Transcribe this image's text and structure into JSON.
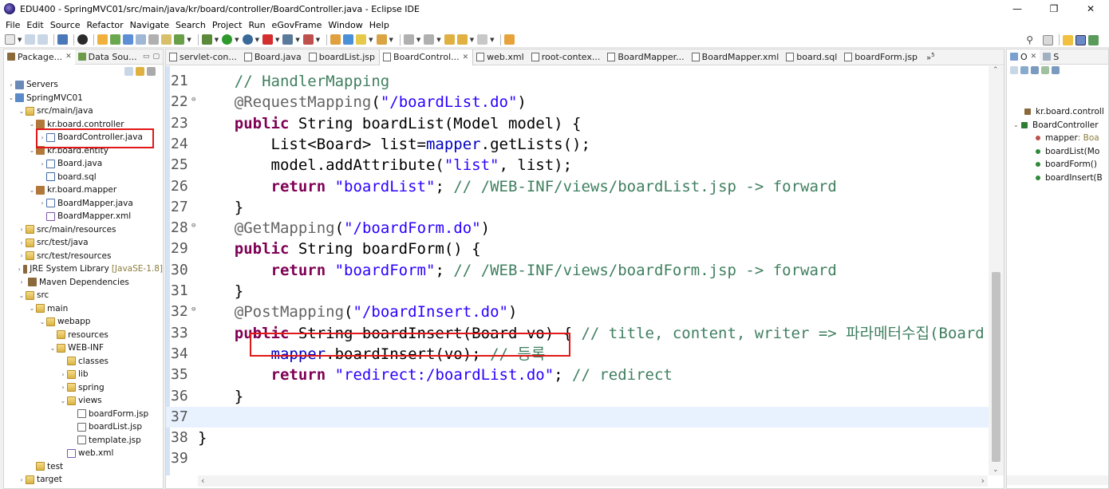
{
  "window": {
    "title": "EDU400 - SpringMVC01/src/main/java/kr/board/controller/BoardController.java - Eclipse IDE",
    "controls": [
      "—",
      "❐",
      "✕"
    ]
  },
  "menubar": [
    "File",
    "Edit",
    "Source",
    "Refactor",
    "Navigate",
    "Search",
    "Project",
    "Run",
    "eGovFrame",
    "Window",
    "Help"
  ],
  "left_view": {
    "tabs": [
      {
        "label": "Package...",
        "close": "✕"
      },
      {
        "label": "Data Sou..."
      }
    ],
    "minmax": [
      "▭",
      "▢"
    ],
    "tree": [
      {
        "depth": 0,
        "twisty": "›",
        "icon": "server",
        "label": "Servers"
      },
      {
        "depth": 0,
        "twisty": "⌄",
        "icon": "proj",
        "label": "SpringMVC01"
      },
      {
        "depth": 1,
        "twisty": "⌄",
        "icon": "folder",
        "label": "src/main/java"
      },
      {
        "depth": 2,
        "twisty": "⌄",
        "icon": "pkg",
        "label": "kr.board.controller"
      },
      {
        "depth": 3,
        "twisty": "›",
        "icon": "java",
        "label": "BoardController.java"
      },
      {
        "depth": 2,
        "twisty": "⌄",
        "icon": "pkg",
        "label": "kr.board.entity"
      },
      {
        "depth": 3,
        "twisty": "›",
        "icon": "java",
        "label": "Board.java"
      },
      {
        "depth": 3,
        "twisty": "",
        "icon": "sql",
        "label": "board.sql"
      },
      {
        "depth": 2,
        "twisty": "⌄",
        "icon": "pkg",
        "label": "kr.board.mapper"
      },
      {
        "depth": 3,
        "twisty": "›",
        "icon": "java",
        "label": "BoardMapper.java"
      },
      {
        "depth": 3,
        "twisty": "",
        "icon": "xml",
        "label": "BoardMapper.xml"
      },
      {
        "depth": 1,
        "twisty": "›",
        "icon": "folder",
        "label": "src/main/resources"
      },
      {
        "depth": 1,
        "twisty": "›",
        "icon": "folder",
        "label": "src/test/java"
      },
      {
        "depth": 1,
        "twisty": "›",
        "icon": "folder",
        "label": "src/test/resources"
      },
      {
        "depth": 1,
        "twisty": "›",
        "icon": "lib",
        "label": "JRE System Library",
        "extra": "[JavaSE-1.8]"
      },
      {
        "depth": 1,
        "twisty": "›",
        "icon": "lib",
        "label": "Maven Dependencies"
      },
      {
        "depth": 1,
        "twisty": "⌄",
        "icon": "folder",
        "label": "src"
      },
      {
        "depth": 2,
        "twisty": "⌄",
        "icon": "folder",
        "label": "main"
      },
      {
        "depth": 3,
        "twisty": "⌄",
        "icon": "folder",
        "label": "webapp"
      },
      {
        "depth": 4,
        "twisty": "",
        "icon": "folder",
        "label": "resources"
      },
      {
        "depth": 4,
        "twisty": "⌄",
        "icon": "folder",
        "label": "WEB-INF"
      },
      {
        "depth": 5,
        "twisty": "",
        "icon": "folder",
        "label": "classes"
      },
      {
        "depth": 5,
        "twisty": "›",
        "icon": "folder",
        "label": "lib"
      },
      {
        "depth": 5,
        "twisty": "›",
        "icon": "folder",
        "label": "spring"
      },
      {
        "depth": 5,
        "twisty": "⌄",
        "icon": "folder",
        "label": "views"
      },
      {
        "depth": 6,
        "twisty": "",
        "icon": "jsp",
        "label": "boardForm.jsp"
      },
      {
        "depth": 6,
        "twisty": "",
        "icon": "jsp",
        "label": "boardList.jsp"
      },
      {
        "depth": 6,
        "twisty": "",
        "icon": "jsp",
        "label": "template.jsp"
      },
      {
        "depth": 5,
        "twisty": "",
        "icon": "xml",
        "label": "web.xml"
      },
      {
        "depth": 2,
        "twisty": "",
        "icon": "folder",
        "label": "test"
      },
      {
        "depth": 1,
        "twisty": "›",
        "icon": "folder",
        "label": "target"
      }
    ]
  },
  "editor": {
    "tabs": [
      {
        "label": "servlet-con..."
      },
      {
        "label": "Board.java"
      },
      {
        "label": "boardList.jsp"
      },
      {
        "label": "BoardControl...",
        "active": true,
        "close": "✕"
      },
      {
        "label": "web.xml"
      },
      {
        "label": "root-contex..."
      },
      {
        "label": "BoardMapper..."
      },
      {
        "label": "BoardMapper.xml"
      },
      {
        "label": "board.sql"
      },
      {
        "label": "boardForm.jsp"
      }
    ],
    "overflow": "»",
    "overflow_count": "5",
    "lines": [
      {
        "n": "21",
        "fold": "",
        "tokens": [
          {
            "t": "    "
          },
          {
            "t": "// HandlerMapping",
            "c": "cm"
          }
        ]
      },
      {
        "n": "22",
        "fold": "⊖",
        "tokens": [
          {
            "t": "    "
          },
          {
            "t": "@RequestMapping",
            "c": "ann"
          },
          {
            "t": "("
          },
          {
            "t": "\"/boardList.do\"",
            "c": "str"
          },
          {
            "t": ")"
          }
        ]
      },
      {
        "n": "23",
        "fold": "",
        "tokens": [
          {
            "t": "    "
          },
          {
            "t": "public",
            "c": "kw"
          },
          {
            "t": " String boardList(Model model) {"
          }
        ]
      },
      {
        "n": "24",
        "fold": "",
        "tokens": [
          {
            "t": "        List<Board> list="
          },
          {
            "t": "mapper",
            "c": "fld"
          },
          {
            "t": ".getLists();"
          }
        ]
      },
      {
        "n": "25",
        "fold": "",
        "tokens": [
          {
            "t": "        model.addAttribute("
          },
          {
            "t": "\"list\"",
            "c": "str"
          },
          {
            "t": ", list);"
          }
        ]
      },
      {
        "n": "26",
        "fold": "",
        "tokens": [
          {
            "t": "        "
          },
          {
            "t": "return",
            "c": "kw"
          },
          {
            "t": " "
          },
          {
            "t": "\"boardList\"",
            "c": "str"
          },
          {
            "t": "; "
          },
          {
            "t": "// /WEB-INF/views/boardList.jsp -> forward",
            "c": "cm"
          }
        ]
      },
      {
        "n": "27",
        "fold": "",
        "tokens": [
          {
            "t": "    }"
          }
        ]
      },
      {
        "n": "28",
        "fold": "⊖",
        "tokens": [
          {
            "t": "    "
          },
          {
            "t": "@GetMapping",
            "c": "ann"
          },
          {
            "t": "("
          },
          {
            "t": "\"/boardForm.do\"",
            "c": "str"
          },
          {
            "t": ")"
          }
        ]
      },
      {
        "n": "29",
        "fold": "",
        "tokens": [
          {
            "t": "    "
          },
          {
            "t": "public",
            "c": "kw"
          },
          {
            "t": " String boardForm() {"
          }
        ]
      },
      {
        "n": "30",
        "fold": "",
        "tokens": [
          {
            "t": "        "
          },
          {
            "t": "return",
            "c": "kw"
          },
          {
            "t": " "
          },
          {
            "t": "\"boardForm\"",
            "c": "str"
          },
          {
            "t": "; "
          },
          {
            "t": "// /WEB-INF/views/boardForm.jsp -> forward",
            "c": "cm"
          }
        ]
      },
      {
        "n": "31",
        "fold": "",
        "tokens": [
          {
            "t": "    }"
          }
        ]
      },
      {
        "n": "32",
        "fold": "⊖",
        "tokens": [
          {
            "t": "    "
          },
          {
            "t": "@PostMapping",
            "c": "ann"
          },
          {
            "t": "("
          },
          {
            "t": "\"/boardInsert.do\"",
            "c": "str"
          },
          {
            "t": ")"
          }
        ]
      },
      {
        "n": "33",
        "fold": "",
        "tokens": [
          {
            "t": "    "
          },
          {
            "t": "public",
            "c": "kw"
          },
          {
            "t": " String boardInsert(Board vo) { "
          },
          {
            "t": "// title, content, writer => 파라메터수집(Board",
            "c": "cm"
          }
        ]
      },
      {
        "n": "34",
        "fold": "",
        "tokens": [
          {
            "t": "        "
          },
          {
            "t": "mapper",
            "c": "fld"
          },
          {
            "t": ".boardInsert(vo); "
          },
          {
            "t": "// 등록",
            "c": "cm"
          }
        ]
      },
      {
        "n": "35",
        "fold": "",
        "tokens": [
          {
            "t": "        "
          },
          {
            "t": "return",
            "c": "kw"
          },
          {
            "t": " "
          },
          {
            "t": "\"redirect:/boardList.do\"",
            "c": "str"
          },
          {
            "t": "; "
          },
          {
            "t": "// redirect",
            "c": "cm"
          }
        ]
      },
      {
        "n": "36",
        "fold": "",
        "tokens": [
          {
            "t": "    }"
          }
        ]
      },
      {
        "n": "37",
        "fold": "",
        "current": true,
        "tokens": []
      },
      {
        "n": "38",
        "fold": "",
        "tokens": [
          {
            "t": "}"
          }
        ]
      },
      {
        "n": "39",
        "fold": "",
        "tokens": []
      }
    ],
    "scroll_left": "‹",
    "scroll_right": "›",
    "scroll_up": "⌃",
    "scroll_down": "⌄"
  },
  "outline": {
    "tabs": [
      {
        "label": "O",
        "close": "✕"
      },
      {
        "label": "S"
      }
    ],
    "items": [
      {
        "label": "kr.board.controll",
        "kind": "package"
      },
      {
        "label": "BoardController",
        "kind": "class",
        "twisty": "⌄"
      },
      {
        "label": "mapper",
        "type": " : Boa",
        "kind": "field"
      },
      {
        "label": "boardList(Mo",
        "kind": "method"
      },
      {
        "label": "boardForm()",
        "kind": "method"
      },
      {
        "label": "boardInsert(B",
        "kind": "method"
      }
    ]
  },
  "colors": {
    "highlight_box": "#e01818",
    "keyword": "#7f0055",
    "string": "#2a00ff",
    "comment": "#3f7f5f",
    "annotation": "#646464",
    "field": "#0000c0"
  },
  "quick_access_icon": "search-icon"
}
